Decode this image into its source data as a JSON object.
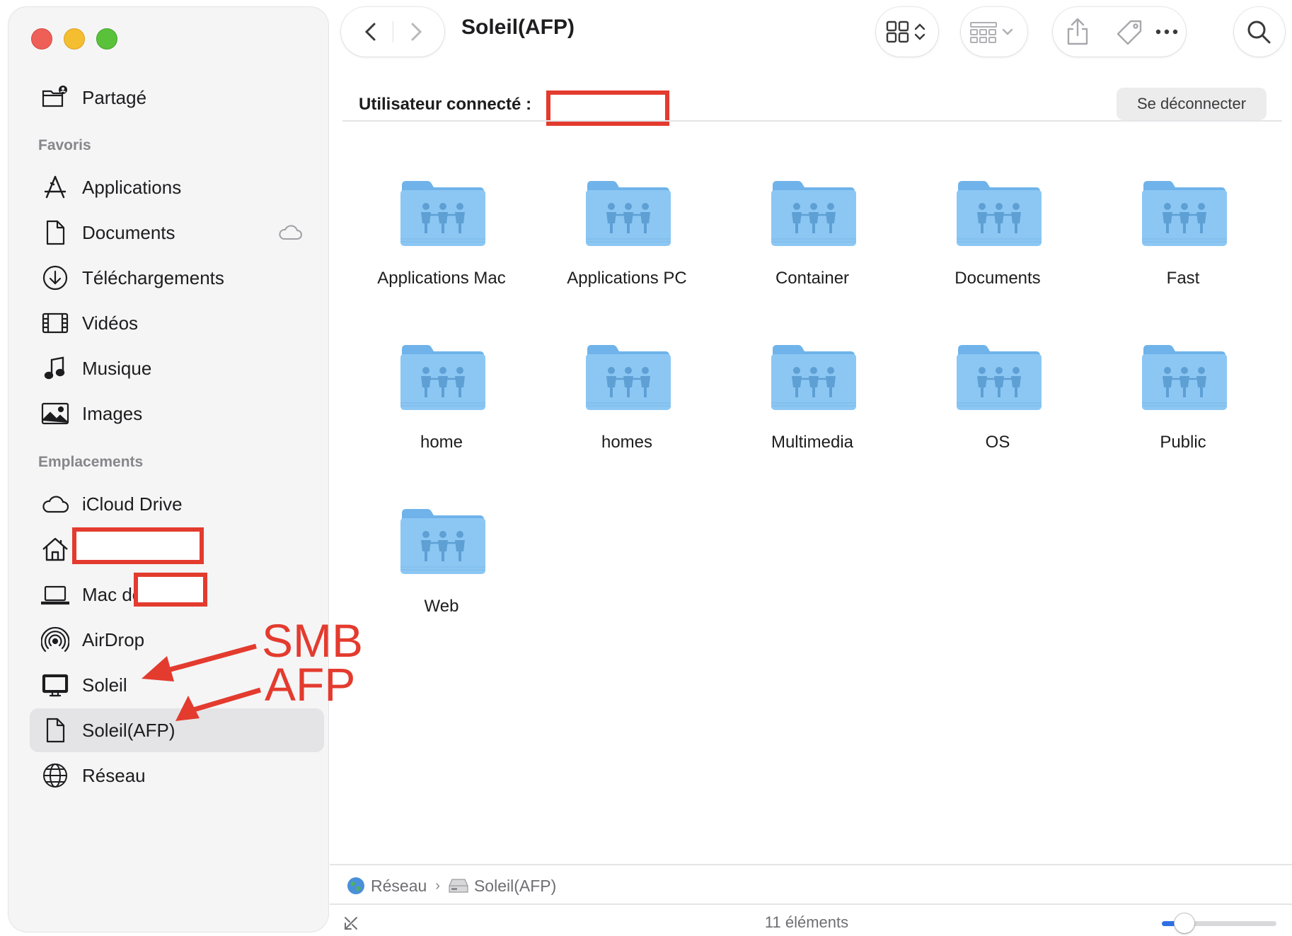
{
  "window": {
    "title": "Soleil(AFP)"
  },
  "sidebar": {
    "shared": {
      "label": "Partagé",
      "icon": "shared-folder-icon"
    },
    "favorites_header": "Favoris",
    "favorites": [
      {
        "label": "Applications",
        "icon": "applications-icon"
      },
      {
        "label": "Documents",
        "icon": "document-icon",
        "badge_icon": "icloud-icon"
      },
      {
        "label": "Téléchargements",
        "icon": "download-icon"
      },
      {
        "label": "Vidéos",
        "icon": "film-icon"
      },
      {
        "label": "Musique",
        "icon": "music-note-icon"
      },
      {
        "label": "Images",
        "icon": "photo-icon"
      }
    ],
    "locations_header": "Emplacements",
    "locations": [
      {
        "label": "iCloud Drive",
        "icon": "cloud-icon"
      },
      {
        "label": "",
        "icon": "home-icon"
      },
      {
        "label": "Mac de",
        "icon": "laptop-icon"
      },
      {
        "label": "AirDrop",
        "icon": "airdrop-icon"
      },
      {
        "label": "Soleil",
        "icon": "display-icon"
      },
      {
        "label": "Soleil(AFP)",
        "icon": "document-icon",
        "selected": true
      },
      {
        "label": "Réseau",
        "icon": "globe-icon"
      }
    ]
  },
  "server_bar": {
    "user_label": "Utilisateur connecté :",
    "disconnect_label": "Se déconnecter"
  },
  "folders": [
    "Applications Mac",
    "Applications PC",
    "Container",
    "Documents",
    "Fast",
    "home",
    "homes",
    "Multimedia",
    "OS",
    "Public",
    "Web"
  ],
  "path_bar": [
    {
      "label": "Réseau",
      "icon": "network-globe-icon"
    },
    {
      "label": "Soleil(AFP)",
      "icon": "server-icon"
    }
  ],
  "status": {
    "item_count": "11 éléments"
  },
  "icon_size_slider": {
    "value": 0.2
  },
  "annotations": {
    "smb": "SMB",
    "afp": "AFP"
  },
  "colors": {
    "accent": "#2f6fe4",
    "folder": "#8cc7f4",
    "annotation_red": "#e33b2e",
    "traffic_red": "#ee5f57",
    "traffic_yellow": "#f5bd30",
    "traffic_green": "#5ac13b"
  }
}
